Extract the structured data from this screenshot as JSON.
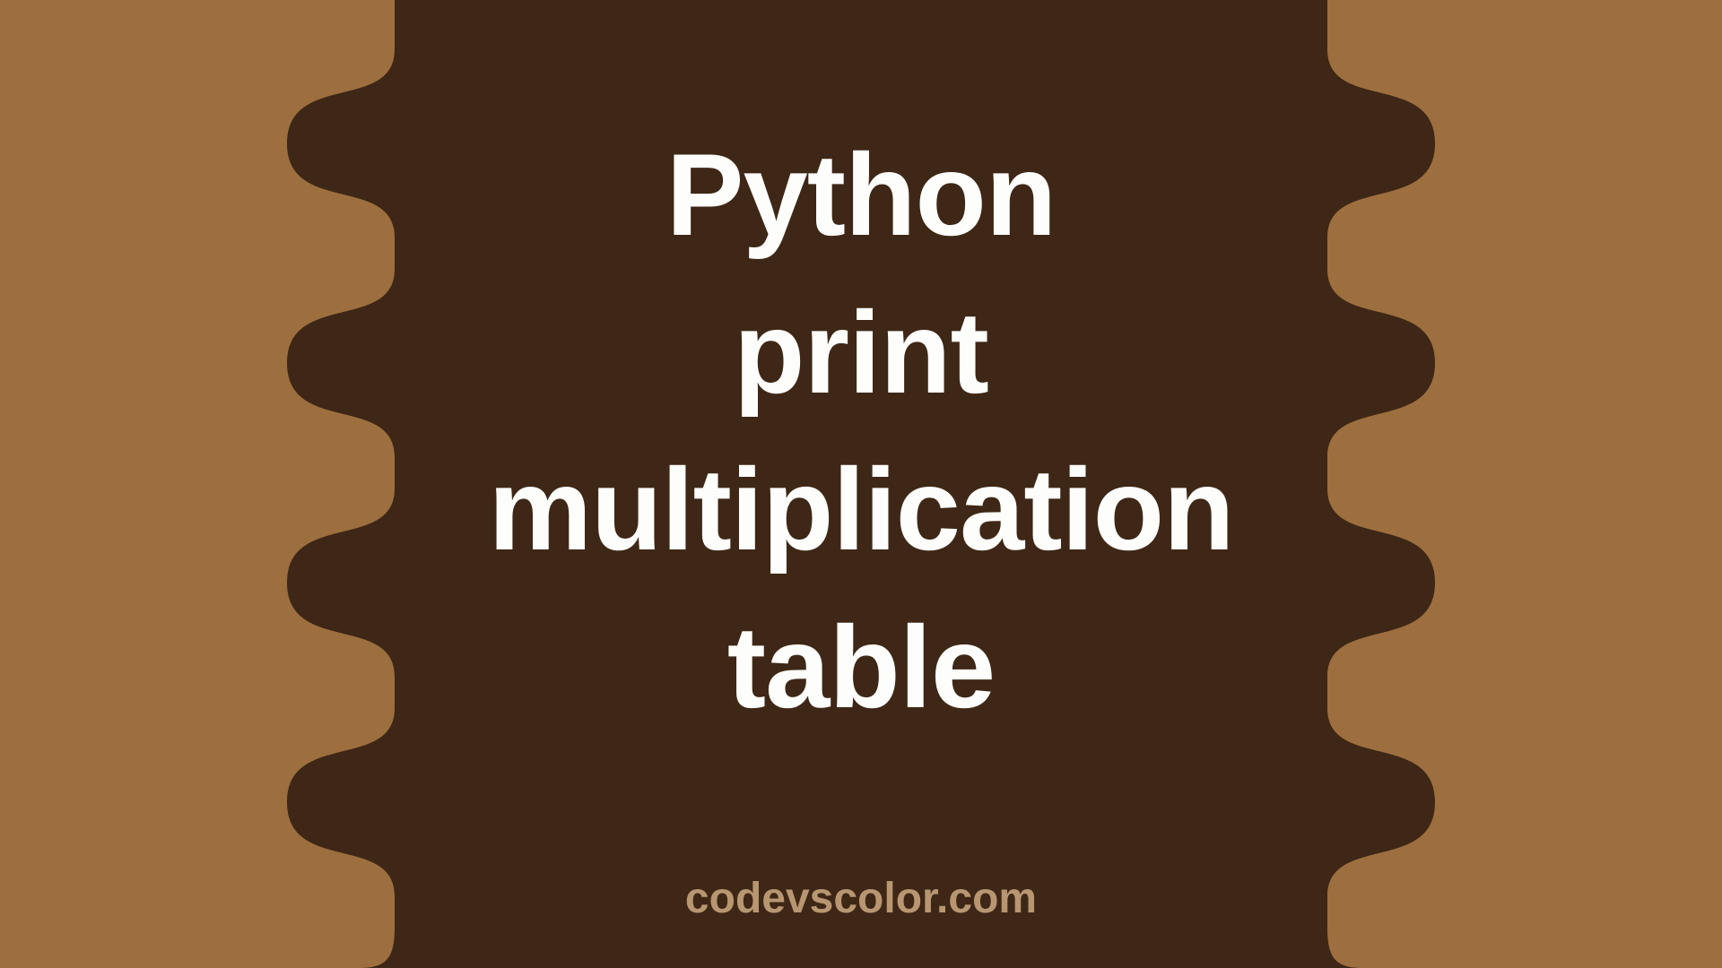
{
  "title": {
    "line1": "Python",
    "line2": "print",
    "line3": "multiplication",
    "line4": "table"
  },
  "watermark": "codevscolor.com",
  "colors": {
    "background": "#9d6f3e",
    "blob": "#3e2716",
    "title_text": "#fdfdfb",
    "watermark_text": "#b79671"
  }
}
